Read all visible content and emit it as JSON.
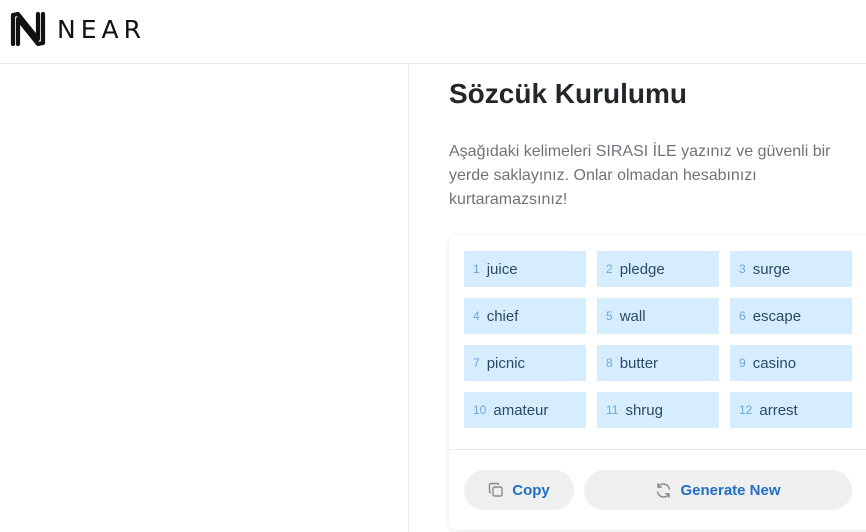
{
  "header": {
    "logo_text": "NEAR"
  },
  "main": {
    "title": "Sözcük Kurulumu",
    "description": "Aşağıdaki kelimeleri SIRASI İLE yazınız ve güvenli bir yerde saklayınız. Onlar olmadan hesabınızı kurtaramazsınız!",
    "words": [
      {
        "num": "1",
        "word": "juice"
      },
      {
        "num": "2",
        "word": "pledge"
      },
      {
        "num": "3",
        "word": "surge"
      },
      {
        "num": "4",
        "word": "chief"
      },
      {
        "num": "5",
        "word": "wall"
      },
      {
        "num": "6",
        "word": "escape"
      },
      {
        "num": "7",
        "word": "picnic"
      },
      {
        "num": "8",
        "word": "butter"
      },
      {
        "num": "9",
        "word": "casino"
      },
      {
        "num": "10",
        "word": "amateur"
      },
      {
        "num": "11",
        "word": "shrug"
      },
      {
        "num": "12",
        "word": "arrest"
      }
    ],
    "copy_label": "Copy",
    "generate_label": "Generate New",
    "copy_icon": "copy-icon",
    "generate_icon": "refresh-icon"
  },
  "colors": {
    "word_bg": "#d6edff",
    "word_num": "#6aa8dd",
    "button_text": "#1f6fc4",
    "button_bg": "#efefef"
  }
}
